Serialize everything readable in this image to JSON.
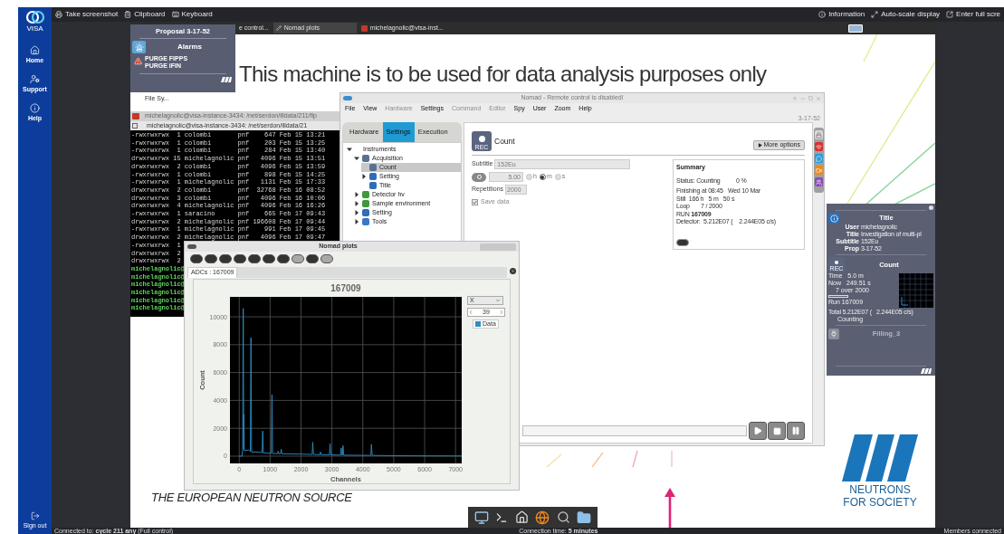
{
  "sidebar": {
    "logo": "VISA",
    "items": [
      {
        "label": "Home",
        "kind": "home"
      },
      {
        "label": "Support",
        "kind": "support"
      },
      {
        "label": "Help",
        "kind": "help"
      }
    ],
    "sign_out": "Sign out"
  },
  "toolbar": {
    "left": [
      {
        "label": "Take screenshot",
        "kind": "screenshot"
      },
      {
        "label": "Clipboard",
        "kind": "clipboard"
      },
      {
        "label": "Keyboard",
        "kind": "keyboard"
      }
    ],
    "right": [
      {
        "label": "Information",
        "kind": "info"
      },
      {
        "label": "Auto-scale display",
        "kind": "scale"
      },
      {
        "label": "Enter full scre",
        "kind": "fullscreen"
      }
    ]
  },
  "desktop": {
    "taskbar": {
      "tabs": [
        {
          "label": "e control...",
          "kind": "generic",
          "selected": false
        },
        {
          "label": "Nomad plots",
          "kind": "plot",
          "selected": true
        },
        {
          "label": "michelagnolic@visa-inst...",
          "kind": "terminal",
          "selected": false
        }
      ]
    },
    "banner": "This machine is to be used for data analysis purposes only",
    "file_label": "File Sy...",
    "proposal_popup": {
      "title": "Proposal 3-17-52",
      "alarms_title": "Alarms",
      "alarms": [
        "PURGE FIPPS",
        "PURGE IFIN"
      ]
    },
    "terminal": {
      "back_title": "michelagnolic@visa-instance-3434: /net/serdon/illdata/211/fip",
      "title": "michelagnolic@visa-instance-3434: /net/serdon/illdata/21",
      "lines": [
        "-rwxrwxrwx  1 colombi       pnf    647 Feb 15 13:21",
        "-rwxrwxrwx  1 colombi       pnf    203 Feb 15 13:25",
        "-rwxrwxrwx  1 colombi       pnf    284 Feb 15 13:40",
        "drwxrwxrwx 15 michelagnolic pnf   4096 Feb 15 13:51",
        "drwxrwxrwx  2 colombi       pnf   4096 Feb 15 13:59",
        "-rwxrwxrwx  1 colombi       pnf    898 Feb 15 14:25",
        "-rwxrwxrwx  1 michelagnolic pnf   1131 Feb 15 17:33",
        "drwxrwxrwx  2 colombi       pnf  32768 Feb 16 08:52",
        "drwxrwxrwx  3 colombi       pnf   4096 Feb 16 10:06",
        "drwxrwxrwx  4 michelagnolic pnf   4096 Feb 16 16:26",
        "-rwxrwxrwx  1 saracino      pnf    665 Feb 17 09:43",
        "drwxrwxrwx  2 michelagnolic pnf 196608 Feb 17 09:44",
        "-rwxrwxrwx  1 michelagnolic pnf    991 Feb 17 09:45",
        "drwxrwxrwx  2 michelagnolic pnf   4096 Feb 17 09:47",
        "-rwxrwxrwx  1",
        "drwxrwxrwx  2",
        "drwxrwxrwx  2"
      ],
      "prompts": [
        "michelagnolic@",
        "michelagnolic@",
        "michelagnolic@",
        "michelagnolic@",
        "michelagnolic@",
        "michelagnolic@"
      ]
    },
    "nomad": {
      "title": "Nomad - Remote control is disabled!",
      "menu": [
        {
          "label": "File",
          "disabled": false
        },
        {
          "label": "View",
          "disabled": false
        },
        {
          "label": "Hardware",
          "disabled": true
        },
        {
          "label": "Settings",
          "disabled": false
        },
        {
          "label": "Command",
          "disabled": true
        },
        {
          "label": "Editor",
          "disabled": true
        },
        {
          "label": "Spy",
          "disabled": false
        },
        {
          "label": "User",
          "disabled": false
        },
        {
          "label": "Zoom",
          "disabled": false
        },
        {
          "label": "Help",
          "disabled": false
        }
      ],
      "proposal": "3-17-52",
      "tabs": [
        {
          "label": "Hardware",
          "selected": false
        },
        {
          "label": "Settings",
          "selected": true
        },
        {
          "label": "Execution",
          "selected": false
        }
      ],
      "tree": [
        {
          "label": "Instruments",
          "kind": "root",
          "expanded": true,
          "selected": false,
          "children": [
            {
              "label": "Acquisition",
              "kind": "acquisition",
              "expanded": true,
              "selected": false,
              "children": [
                {
                  "label": "Count",
                  "kind": "count",
                  "selected": true
                },
                {
                  "label": "Setting",
                  "kind": "setting",
                  "expanded": false,
                  "selected": false
                },
                {
                  "label": "Title",
                  "kind": "title",
                  "selected": false
                }
              ]
            },
            {
              "label": "Detector hv",
              "kind": "detector",
              "expanded": false,
              "selected": false
            },
            {
              "label": "Sample environment",
              "kind": "sample",
              "expanded": false,
              "selected": false
            },
            {
              "label": "Setting",
              "kind": "setting",
              "expanded": false,
              "selected": false
            },
            {
              "label": "Tools",
              "kind": "tools",
              "expanded": false,
              "selected": false
            }
          ]
        }
      ],
      "command": {
        "rec_label": "REC",
        "title": "Count",
        "more_options": "More options",
        "disabled": true,
        "subtitle_label": "Subtitle",
        "subtitle_value": "152Eu",
        "time_value": "5.00",
        "units": [
          {
            "label": "h",
            "selected": false
          },
          {
            "label": "m",
            "selected": true
          },
          {
            "label": "s",
            "selected": false
          }
        ],
        "repetitions_label": "Repetitions",
        "repetitions_value": "2000",
        "save_data": {
          "label": "Save data",
          "checked": true
        }
      },
      "summary": {
        "title": "Summary",
        "lines": [
          "Status: Counting          0 %",
          "Finishing at 08:45   Wed 10 Mar",
          "Still  166 h   5 m   50 s",
          "Loop       7 / 2000",
          "RUN **167009**",
          "Detector:  5.212E07 (    2.244E05 c/s)"
        ]
      }
    },
    "plots": {
      "title": "Nomad plots",
      "tools": [
        {
          "disabled": false
        },
        {
          "disabled": false
        },
        {
          "disabled": false
        },
        {
          "disabled": false
        },
        {
          "disabled": false
        },
        {
          "disabled": false
        },
        {
          "disabled": false
        },
        {
          "disabled": true
        },
        {
          "disabled": false
        },
        {
          "disabled": true
        }
      ],
      "tab": "ADCs : 167009",
      "axis_select": "X",
      "spinner": "39",
      "chart_data": {
        "type": "line",
        "title": "167009",
        "xlabel": "Channels",
        "ylabel": "Count",
        "x": [
          0,
          90,
          110,
          130,
          145,
          150,
          160,
          300,
          360,
          380,
          400,
          700,
          740,
          760,
          780,
          1040,
          1060,
          1080,
          1240,
          1260,
          1280,
          1340,
          1360,
          1380,
          2000,
          2360,
          2380,
          2400,
          2610,
          2630,
          2650,
          2920,
          2940,
          2960,
          3280,
          3300,
          3320,
          3340,
          3360,
          3380,
          4260,
          4280,
          4300,
          5000,
          6000,
          7200
        ],
        "series": [
          {
            "name": "Data",
            "color": "#2a8fc4",
            "values": [
              0,
              0,
              500,
              10600,
              500,
              3000,
              400,
              450,
              350,
              8500,
              300,
              280,
              250,
              1800,
              230,
              200,
              4400,
              190,
              180,
              350,
              180,
              180,
              500,
              170,
              150,
              120,
              1000,
              120,
              110,
              300,
              110,
              100,
              900,
              100,
              80,
              600,
              80,
              80,
              750,
              70,
              50,
              850,
              50,
              30,
              20,
              10
            ]
          }
        ],
        "grid": true,
        "xlim": [
          -300,
          7200
        ],
        "ylim": [
          -520,
          11430
        ],
        "xticks": [
          0,
          1000,
          2000,
          3000,
          4000,
          5000,
          6000,
          7000
        ],
        "yticks": [
          0,
          2000,
          4000,
          6000,
          8000,
          10000
        ]
      }
    },
    "status_panel": {
      "info": {
        "title": "Title",
        "fields": [
          {
            "label": "User",
            "value": "michelagnolic"
          },
          {
            "label": "Title",
            "value": "Investigation of multi-pl"
          },
          {
            "label": "Subtitle",
            "value": "152Eu"
          },
          {
            "label": "Prop",
            "value": "3-17-52"
          }
        ]
      },
      "count": {
        "rec_label": "REC",
        "title": "Count",
        "time_label": "Time",
        "time_value": "5.0 m",
        "now_label": "Now",
        "now_value": "249.51 s",
        "loops": "7 over 2000",
        "level": 0.0035,
        "run": "Run 167009",
        "total": "Total 5.212E07 (   2.244E05 c/s)",
        "state": "Counting"
      },
      "filling": {
        "label": "Filling_3",
        "disabled": true
      }
    },
    "tagline": "THE EUROPEAN NEUTRON SOURCE",
    "logo_lines": [
      "NEUTRONS",
      "FOR SOCIETY"
    ]
  },
  "status_bar": {
    "connected": "Connected to: **cycle 211 any** (Full control)",
    "time": "Connection time: **5 minutes**",
    "members": "Members connected"
  }
}
